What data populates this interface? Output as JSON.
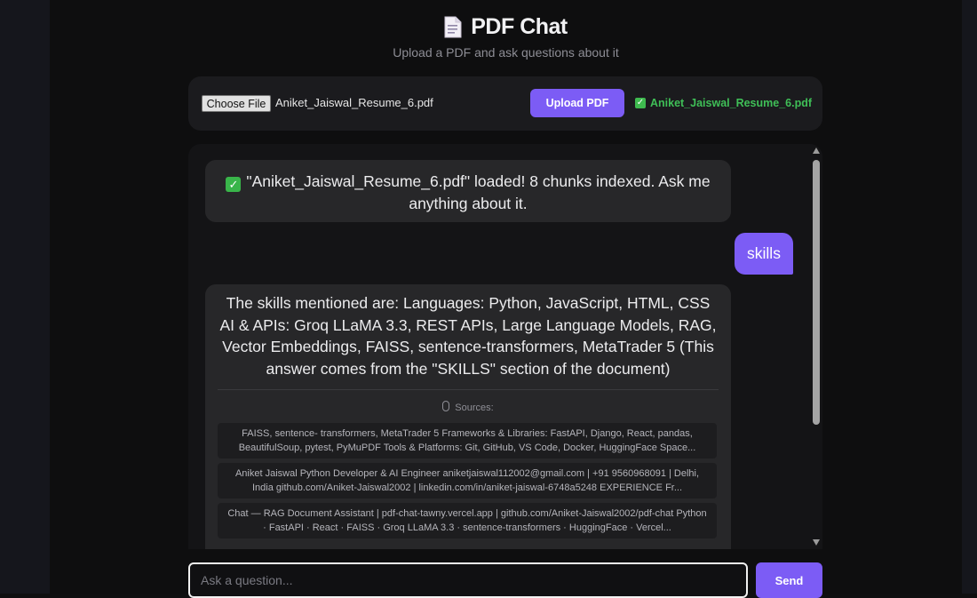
{
  "header": {
    "icon": "document-icon",
    "title": "PDF Chat",
    "subtitle": "Upload a PDF and ask questions about it"
  },
  "upload": {
    "choose_label": "Choose File",
    "selected_file": "Aniket_Jaiswal_Resume_6.pdf",
    "upload_label": "Upload PDF",
    "loaded_file": "Aniket_Jaiswal_Resume_6.pdf"
  },
  "chat": {
    "system_message": "\"Aniket_Jaiswal_Resume_6.pdf\" loaded! 8 chunks indexed. Ask me anything about it.",
    "user_message": "skills",
    "answer": "The skills mentioned are: Languages: Python, JavaScript, HTML, CSS AI & APIs: Groq LLaMA 3.3, REST APIs, Large Language Models, RAG, Vector Embeddings, FAISS, sentence-transformers, MetaTrader 5 (This answer comes from the \"SKILLS\" section of the document)",
    "sources_label": "Sources:",
    "sources": [
      "FAISS, sentence- transformers, MetaTrader 5 Frameworks & Libraries: FastAPI, Django, React, pandas, BeautifulSoup, pytest, PyMuPDF Tools & Platforms: Git, GitHub, VS Code, Docker, HuggingFace Space...",
      "Aniket Jaiswal Python Developer & AI Engineer aniketjaiswal112002@gmail.com | +91 9560968091 | Delhi, India github.com/Aniket-Jaiswal2002 | linkedin.com/in/aniket-jaiswal-6748a5248 EXPERIENCE Fr...",
      "Chat — RAG Document Assistant | pdf-chat-tawny.vercel.app | github.com/Aniket-Jaiswal2002/pdf-chat Python · FastAPI · React · FAISS · Groq LLaMA 3.3 · sentence-transformers · HuggingFace · Vercel..."
    ]
  },
  "composer": {
    "placeholder": "Ask a question...",
    "send_label": "Send"
  },
  "colors": {
    "accent": "#7c5cf5",
    "success": "#3fbf57",
    "background": "#0e0e0f",
    "panel": "#1b1b1e"
  }
}
